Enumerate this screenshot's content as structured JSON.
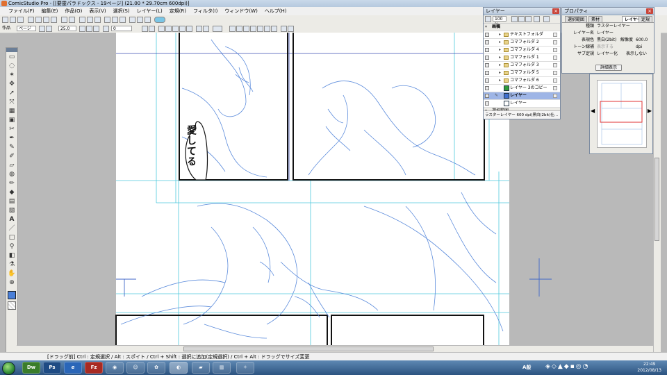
{
  "window": {
    "title": "ComicStudio Pro - [[要靈パラドックス - 19ページ] (21.00 * 29.70cm 600dpi)]"
  },
  "menu": {
    "items": [
      "ファイル(F)",
      "編集(E)",
      "作品(O)",
      "表示(V)",
      "選択(S)",
      "レイヤー(L)",
      "定規(R)",
      "フィルタ(I)",
      "ウィンドウ(W)",
      "ヘルプ(H)"
    ]
  },
  "toolbar2": {
    "mode_label": "作品",
    "page_label": "ページ",
    "zoom_value": "25.0",
    "rotate_value": "0"
  },
  "manuscript": {
    "speech_text": "愛してる"
  },
  "layer_panel": {
    "title": "レイヤー",
    "opacity": "100 %",
    "group_name": "画稿",
    "layers": [
      {
        "name": "テキストフォルダ",
        "kind": "folder"
      },
      {
        "name": "コマフォルダ 2",
        "kind": "folder"
      },
      {
        "name": "コマフォルダ 4",
        "kind": "folder"
      },
      {
        "name": "コマフォルダ 1",
        "kind": "folder"
      },
      {
        "name": "コマフォルダ 3",
        "kind": "folder"
      },
      {
        "name": "コマフォルダ 5",
        "kind": "folder"
      },
      {
        "name": "コマフォルダ 6",
        "kind": "folder"
      },
      {
        "name": "レイヤー 3のコピー",
        "kind": "layer"
      },
      {
        "name": "レイヤー",
        "kind": "layer",
        "selected": true
      },
      {
        "name": "レイヤー",
        "kind": "layer"
      }
    ],
    "bottom_item": "選択範囲",
    "status": "ラスターレイヤー 600 dpi(黒白(2bit)仕..."
  },
  "property_panel": {
    "title": "プロパティ",
    "tabs": [
      "選択範囲",
      "素材",
      "レイヤー",
      "定規"
    ],
    "active_tab": "レイヤー",
    "rows": [
      {
        "key": "種類",
        "value": "ラスターレイヤー"
      },
      {
        "key": "レイヤー名",
        "value": "レイヤー"
      },
      {
        "key": "表現色",
        "value": "黒白(2bit)"
      },
      {
        "key": "トーン線補",
        "value": "表示する"
      },
      {
        "key": "サブ定規",
        "value": "レイヤー化"
      }
    ],
    "resolution_label": "解像度",
    "resolution_value": "600.0 dpi",
    "hidden_label": "表示しない",
    "detail_button": "詳細表示"
  },
  "statusbar": {
    "text": "[ドラッグ前] Ctrl : 定規選択 / Alt : スポイト / Ctrl + Shift : 選択に追加(定規選択) / Ctrl + Alt : ドラッグでサイズ変更"
  },
  "taskbar": {
    "apps": [
      "Dw",
      "Ps",
      "e",
      "Fz"
    ],
    "time": "22:49",
    "date": "2012/08/13",
    "tray_text": "A般"
  },
  "colors": {
    "sketch_blue": "#4a7fd8",
    "guide_cyan": "#4ec9dc",
    "panel_border": "#111111"
  }
}
